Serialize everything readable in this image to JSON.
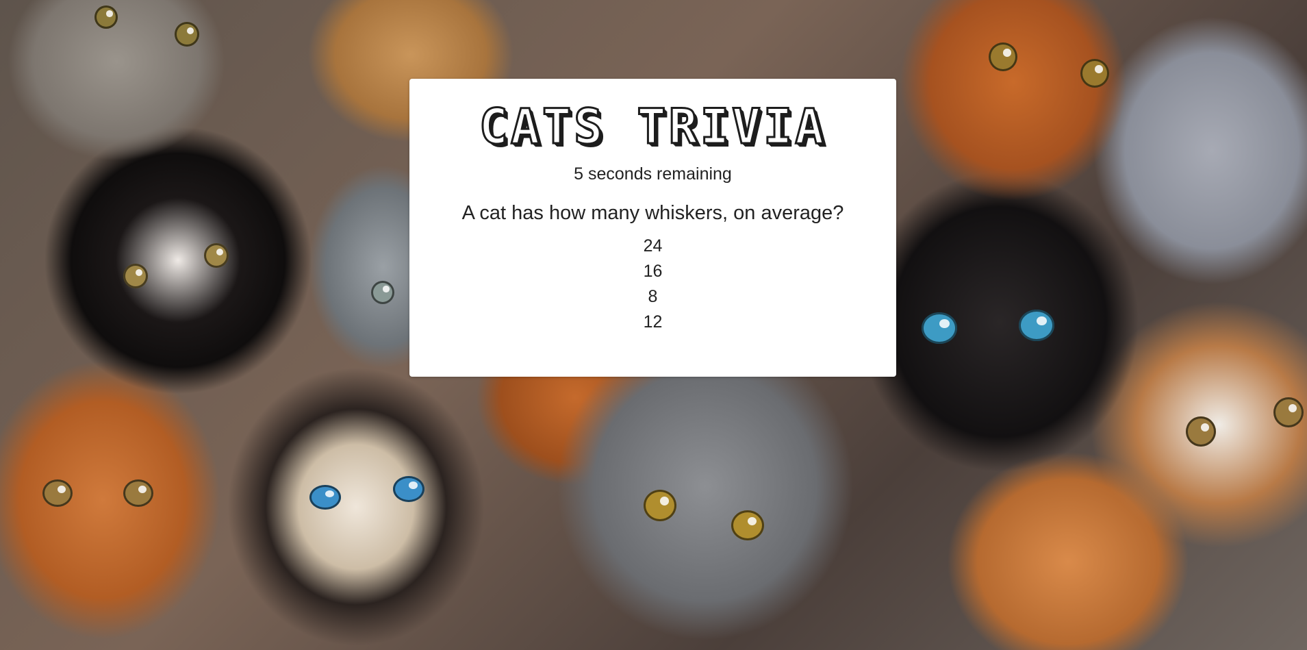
{
  "title": "CATS TRIVIA",
  "timer_text": "5 seconds remaining",
  "question": "A cat has how many whiskers, on average?",
  "answers": [
    "24",
    "16",
    "8",
    "12"
  ],
  "background": "cat photo collage",
  "colors": {
    "card": "#ffffff",
    "text": "#222222",
    "title_outline": "#1d1d1d"
  }
}
